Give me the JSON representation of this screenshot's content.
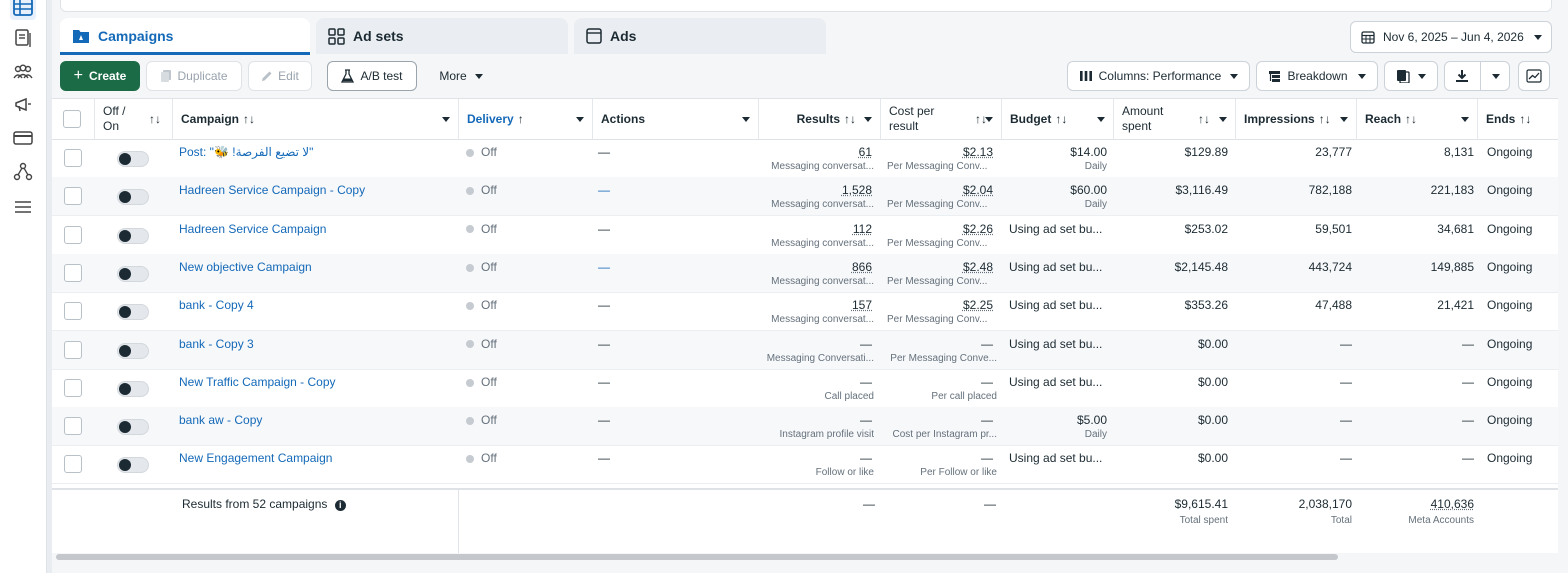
{
  "tabs": [
    {
      "label": "Campaigns"
    },
    {
      "label": "Ad sets"
    },
    {
      "label": "Ads"
    }
  ],
  "date_range": "Nov 6, 2025 – Jun 4, 2026",
  "toolbar": {
    "create": "Create",
    "duplicate": "Duplicate",
    "edit": "Edit",
    "ab_test": "A/B test",
    "more": "More",
    "columns": "Columns: Performance",
    "breakdown": "Breakdown"
  },
  "columns": {
    "off_on": "Off / On",
    "campaign": "Campaign",
    "delivery": "Delivery",
    "actions": "Actions",
    "results": "Results",
    "cost_per_result": "Cost per result",
    "budget": "Budget",
    "amount_spent": "Amount spent",
    "impressions": "Impressions",
    "reach": "Reach",
    "ends": "Ends",
    "sort_glyph": "↑↓",
    "sort_asc_glyph": "↑"
  },
  "rows": [
    {
      "name": "Post: \"🐝 !لا تضيع الفرصة\"",
      "delivery": "Off",
      "actions": "—",
      "results": "61",
      "results_sub": "Messaging conversat...",
      "cost": "$2.13",
      "cost_sub": "Per Messaging Conv...",
      "budget": "$14.00",
      "budget_sub": "Daily",
      "spent": "$129.89",
      "impressions": "23,777",
      "reach": "8,131",
      "ends": "Ongoing"
    },
    {
      "name": "Hadreen Service Campaign - Copy",
      "delivery": "Off",
      "actions": "—",
      "results": "1,528",
      "results_sub": "Messaging conversat...",
      "cost": "$2.04",
      "cost_sub": "Per Messaging Conv...",
      "budget": "$60.00",
      "budget_sub": "Daily",
      "spent": "$3,116.49",
      "impressions": "782,188",
      "reach": "221,183",
      "ends": "Ongoing"
    },
    {
      "name": "Hadreen Service Campaign",
      "delivery": "Off",
      "actions": "—",
      "results": "112",
      "results_sub": "Messaging conversat...",
      "cost": "$2.26",
      "cost_sub": "Per Messaging Conv...",
      "budget": "Using ad set bu...",
      "budget_sub": "",
      "spent": "$253.02",
      "impressions": "59,501",
      "reach": "34,681",
      "ends": "Ongoing"
    },
    {
      "name": "New objective Campaign",
      "delivery": "Off",
      "actions": "—",
      "results": "866",
      "results_sub": "Messaging conversat...",
      "cost": "$2.48",
      "cost_sub": "Per Messaging Conv...",
      "budget": "Using ad set bu...",
      "budget_sub": "",
      "spent": "$2,145.48",
      "impressions": "443,724",
      "reach": "149,885",
      "ends": "Ongoing"
    },
    {
      "name": "bank - Copy 4",
      "delivery": "Off",
      "actions": "—",
      "results": "157",
      "results_sub": "Messaging conversat...",
      "cost": "$2.25",
      "cost_sub": "Per Messaging Conv...",
      "budget": "Using ad set bu...",
      "budget_sub": "",
      "spent": "$353.26",
      "impressions": "47,488",
      "reach": "21,421",
      "ends": "Ongoing"
    },
    {
      "name": "bank - Copy 3",
      "delivery": "Off",
      "actions": "—",
      "results": "—",
      "results_sub": "Messaging Conversati...",
      "cost": "—",
      "cost_sub": "Per Messaging Conve...",
      "budget": "Using ad set bu...",
      "budget_sub": "",
      "spent": "$0.00",
      "impressions": "—",
      "reach": "—",
      "ends": "Ongoing"
    },
    {
      "name": "New Traffic Campaign - Copy",
      "delivery": "Off",
      "actions": "—",
      "results": "—",
      "results_sub": "Call placed",
      "cost": "—",
      "cost_sub": "Per call placed",
      "budget": "Using ad set bu...",
      "budget_sub": "",
      "spent": "$0.00",
      "impressions": "—",
      "reach": "—",
      "ends": "Ongoing"
    },
    {
      "name": "bank aw - Copy",
      "delivery": "Off",
      "actions": "—",
      "results": "—",
      "results_sub": "Instagram profile visit",
      "cost": "—",
      "cost_sub": "Cost per Instagram pr...",
      "budget": "$5.00",
      "budget_sub": "Daily",
      "spent": "$0.00",
      "impressions": "—",
      "reach": "—",
      "ends": "Ongoing"
    },
    {
      "name": "New Engagement Campaign",
      "delivery": "Off",
      "actions": "—",
      "results": "—",
      "results_sub": "Follow or like",
      "cost": "—",
      "cost_sub": "Per Follow or like",
      "budget": "Using ad set bu...",
      "budget_sub": "",
      "spent": "$0.00",
      "impressions": "—",
      "reach": "—",
      "ends": "Ongoing"
    }
  ],
  "totals": {
    "label": "Results from 52 campaigns",
    "results": "—",
    "cost": "—",
    "spent": "$9,615.41",
    "spent_sub": "Total spent",
    "impressions": "2,038,170",
    "impressions_sub": "Total",
    "reach": "410,636",
    "reach_sub": "Meta Accounts"
  },
  "colors": {
    "accent": "#1469b8",
    "create_button": "#1c6b47",
    "off_dot": "#c5cbd1"
  }
}
